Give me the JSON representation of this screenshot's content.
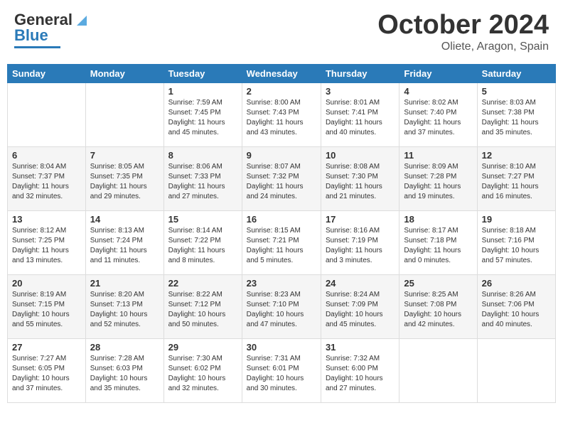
{
  "header": {
    "logo": {
      "line1": "General",
      "line2": "Blue"
    },
    "month": "October 2024",
    "location": "Oliete, Aragon, Spain"
  },
  "days_of_week": [
    "Sunday",
    "Monday",
    "Tuesday",
    "Wednesday",
    "Thursday",
    "Friday",
    "Saturday"
  ],
  "weeks": [
    [
      {
        "day": "",
        "info": ""
      },
      {
        "day": "",
        "info": ""
      },
      {
        "day": "1",
        "info": "Sunrise: 7:59 AM\nSunset: 7:45 PM\nDaylight: 11 hours and 45 minutes."
      },
      {
        "day": "2",
        "info": "Sunrise: 8:00 AM\nSunset: 7:43 PM\nDaylight: 11 hours and 43 minutes."
      },
      {
        "day": "3",
        "info": "Sunrise: 8:01 AM\nSunset: 7:41 PM\nDaylight: 11 hours and 40 minutes."
      },
      {
        "day": "4",
        "info": "Sunrise: 8:02 AM\nSunset: 7:40 PM\nDaylight: 11 hours and 37 minutes."
      },
      {
        "day": "5",
        "info": "Sunrise: 8:03 AM\nSunset: 7:38 PM\nDaylight: 11 hours and 35 minutes."
      }
    ],
    [
      {
        "day": "6",
        "info": "Sunrise: 8:04 AM\nSunset: 7:37 PM\nDaylight: 11 hours and 32 minutes."
      },
      {
        "day": "7",
        "info": "Sunrise: 8:05 AM\nSunset: 7:35 PM\nDaylight: 11 hours and 29 minutes."
      },
      {
        "day": "8",
        "info": "Sunrise: 8:06 AM\nSunset: 7:33 PM\nDaylight: 11 hours and 27 minutes."
      },
      {
        "day": "9",
        "info": "Sunrise: 8:07 AM\nSunset: 7:32 PM\nDaylight: 11 hours and 24 minutes."
      },
      {
        "day": "10",
        "info": "Sunrise: 8:08 AM\nSunset: 7:30 PM\nDaylight: 11 hours and 21 minutes."
      },
      {
        "day": "11",
        "info": "Sunrise: 8:09 AM\nSunset: 7:28 PM\nDaylight: 11 hours and 19 minutes."
      },
      {
        "day": "12",
        "info": "Sunrise: 8:10 AM\nSunset: 7:27 PM\nDaylight: 11 hours and 16 minutes."
      }
    ],
    [
      {
        "day": "13",
        "info": "Sunrise: 8:12 AM\nSunset: 7:25 PM\nDaylight: 11 hours and 13 minutes."
      },
      {
        "day": "14",
        "info": "Sunrise: 8:13 AM\nSunset: 7:24 PM\nDaylight: 11 hours and 11 minutes."
      },
      {
        "day": "15",
        "info": "Sunrise: 8:14 AM\nSunset: 7:22 PM\nDaylight: 11 hours and 8 minutes."
      },
      {
        "day": "16",
        "info": "Sunrise: 8:15 AM\nSunset: 7:21 PM\nDaylight: 11 hours and 5 minutes."
      },
      {
        "day": "17",
        "info": "Sunrise: 8:16 AM\nSunset: 7:19 PM\nDaylight: 11 hours and 3 minutes."
      },
      {
        "day": "18",
        "info": "Sunrise: 8:17 AM\nSunset: 7:18 PM\nDaylight: 11 hours and 0 minutes."
      },
      {
        "day": "19",
        "info": "Sunrise: 8:18 AM\nSunset: 7:16 PM\nDaylight: 10 hours and 57 minutes."
      }
    ],
    [
      {
        "day": "20",
        "info": "Sunrise: 8:19 AM\nSunset: 7:15 PM\nDaylight: 10 hours and 55 minutes."
      },
      {
        "day": "21",
        "info": "Sunrise: 8:20 AM\nSunset: 7:13 PM\nDaylight: 10 hours and 52 minutes."
      },
      {
        "day": "22",
        "info": "Sunrise: 8:22 AM\nSunset: 7:12 PM\nDaylight: 10 hours and 50 minutes."
      },
      {
        "day": "23",
        "info": "Sunrise: 8:23 AM\nSunset: 7:10 PM\nDaylight: 10 hours and 47 minutes."
      },
      {
        "day": "24",
        "info": "Sunrise: 8:24 AM\nSunset: 7:09 PM\nDaylight: 10 hours and 45 minutes."
      },
      {
        "day": "25",
        "info": "Sunrise: 8:25 AM\nSunset: 7:08 PM\nDaylight: 10 hours and 42 minutes."
      },
      {
        "day": "26",
        "info": "Sunrise: 8:26 AM\nSunset: 7:06 PM\nDaylight: 10 hours and 40 minutes."
      }
    ],
    [
      {
        "day": "27",
        "info": "Sunrise: 7:27 AM\nSunset: 6:05 PM\nDaylight: 10 hours and 37 minutes."
      },
      {
        "day": "28",
        "info": "Sunrise: 7:28 AM\nSunset: 6:03 PM\nDaylight: 10 hours and 35 minutes."
      },
      {
        "day": "29",
        "info": "Sunrise: 7:30 AM\nSunset: 6:02 PM\nDaylight: 10 hours and 32 minutes."
      },
      {
        "day": "30",
        "info": "Sunrise: 7:31 AM\nSunset: 6:01 PM\nDaylight: 10 hours and 30 minutes."
      },
      {
        "day": "31",
        "info": "Sunrise: 7:32 AM\nSunset: 6:00 PM\nDaylight: 10 hours and 27 minutes."
      },
      {
        "day": "",
        "info": ""
      },
      {
        "day": "",
        "info": ""
      }
    ]
  ]
}
